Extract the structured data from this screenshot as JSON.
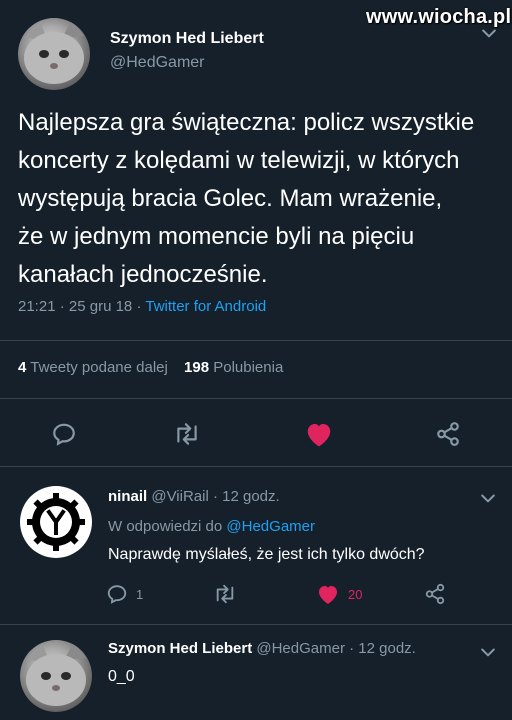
{
  "watermark": "www.wiocha.pl",
  "main_tweet": {
    "name": "Szymon Hed Liebert",
    "handle": "@HedGamer",
    "lines": [
      "Najlepsza gra świąteczna: policz wszystkie",
      "koncerty z kolędami w telewizji, w których",
      "występują bracia Golec. Mam wrażenie,",
      "że w jednym momencie byli na pięciu",
      "kanałach jednocześnie."
    ],
    "time": "21:21",
    "date_sep": "·",
    "date": "25 gru 18",
    "client": "Twitter for Android",
    "retweets_count": "4",
    "retweets_label": "Tweety podane dalej",
    "likes_count": "198",
    "likes_label": "Polubienia"
  },
  "reply1": {
    "name": "ninail",
    "handle": "@ViiRail",
    "time": "· 12 godz.",
    "reply_prefix": "W odpowiedzi do",
    "reply_to": "@HedGamer",
    "text": "Naprawdę myślałeś, że jest ich tylko dwóch?",
    "replies": "1",
    "likes": "20"
  },
  "reply2": {
    "name": "Szymon Hed Liebert",
    "handle": "@HedGamer",
    "time": "· 12 godz.",
    "text": "0_0"
  },
  "colors": {
    "background": "#15202b",
    "muted": "#8899a6",
    "accent": "#1da1f2",
    "like": "#e0245e",
    "divider": "#38444d"
  },
  "icons": [
    "reply-icon",
    "retweet-icon",
    "heart-filled-icon",
    "share-icon",
    "chevron-down-icon"
  ]
}
